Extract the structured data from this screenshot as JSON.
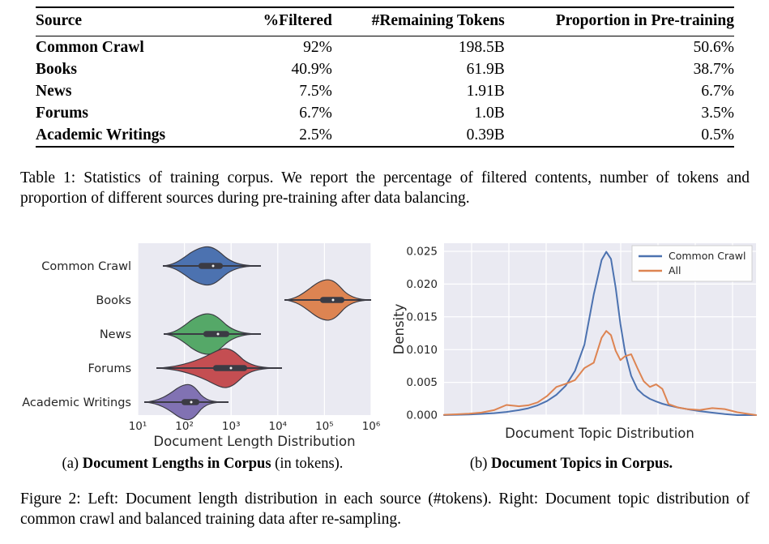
{
  "table": {
    "headers": [
      "Source",
      "%Filtered",
      "#Remaining Tokens",
      "Proportion in Pre-training"
    ],
    "rows": [
      {
        "source": "Common Crawl",
        "filtered": "92%",
        "tokens": "198.5B",
        "proportion": "50.6%"
      },
      {
        "source": "Books",
        "filtered": "40.9%",
        "tokens": "61.9B",
        "proportion": "38.7%"
      },
      {
        "source": "News",
        "filtered": "7.5%",
        "tokens": "1.91B",
        "proportion": "6.7%"
      },
      {
        "source": "Forums",
        "filtered": "6.7%",
        "tokens": "1.0B",
        "proportion": "3.5%"
      },
      {
        "source": "Academic Writings",
        "filtered": "2.5%",
        "tokens": "0.39B",
        "proportion": "0.5%"
      }
    ],
    "caption": "Table 1: Statistics of training corpus. We report the percentage of filtered contents, number of tokens and proportion of different sources during pre-training after data balancing."
  },
  "figure": {
    "caption": "Figure 2: Left: Document length distribution in each source (#tokens). Right: Document topic distribution of common crawl and balanced training data after re-sampling.",
    "subcaption_a_bold": "Document Lengths in Corpus",
    "subcaption_a_rest": " (in tokens).",
    "subcaption_a_prefix": "(a) ",
    "subcaption_b_bold": "Document Topics in Corpus.",
    "subcaption_b_prefix": "(b) "
  },
  "chart_data": [
    {
      "type": "violin",
      "panel": "a",
      "title": "Document Lengths in Corpus (in tokens)",
      "xlabel": "Document Length Distribution",
      "ylabel": "",
      "x_scale": "log10",
      "xlim": [
        1,
        6
      ],
      "xticks": [
        1,
        2,
        3,
        4,
        5,
        6
      ],
      "xticklabels": [
        "10¹",
        "10²",
        "10³",
        "10⁴",
        "10⁵",
        "10⁶"
      ],
      "grid": true,
      "categories": [
        "Common Crawl",
        "Books",
        "News",
        "Forums",
        "Academic Writings"
      ],
      "colors": [
        "#4C72B0",
        "#DD8452",
        "#55A868",
        "#C44E52",
        "#8172B3"
      ],
      "violins": [
        {
          "name": "Common Crawl",
          "color": "#4C72B0",
          "median": 2.78,
          "q1": 2.45,
          "q3": 3.02,
          "whisker_low": 1.72,
          "whisker_high": 3.52,
          "kde_center": 2.52,
          "kde_width": 0.52,
          "tail_low": 1.55,
          "tail_high": 3.95
        },
        {
          "name": "Books",
          "color": "#DD8452",
          "median": 5.18,
          "q1": 4.85,
          "q3": 5.4,
          "whisker_low": 4.02,
          "whisker_high": 5.92,
          "kde_center": 5.12,
          "kde_width": 0.5,
          "tail_low": 3.85,
          "tail_high": 6.0
        },
        {
          "name": "News",
          "color": "#55A868",
          "median": 2.85,
          "q1": 2.56,
          "q3": 3.02,
          "whisker_low": 1.75,
          "whisker_high": 3.5,
          "kde_center": 2.6,
          "kde_width": 0.52,
          "tail_low": 1.58,
          "tail_high": 3.9
        },
        {
          "name": "Forums",
          "color": "#C44E52",
          "median": 3.22,
          "q1": 2.82,
          "q3": 3.52,
          "whisker_low": 1.52,
          "whisker_high": 3.95,
          "kde_center": 3.02,
          "kde_width": 0.48,
          "tail_low": 1.4,
          "tail_high": 4.25
        },
        {
          "name": "Academic Writings",
          "color": "#8172B3",
          "median": 2.18,
          "q1": 2.0,
          "q3": 2.4,
          "whisker_low": 1.18,
          "whisker_high": 3.1,
          "kde_center": 2.1,
          "kde_width": 0.38,
          "tail_low": 1.05,
          "tail_high": 3.3
        }
      ]
    },
    {
      "type": "line",
      "panel": "b",
      "title": "Document Topics in Corpus",
      "xlabel": "Document Topic Distribution",
      "ylabel": "Density",
      "ylim": [
        0.0,
        0.0265
      ],
      "yticks": [
        0.0,
        0.005,
        0.01,
        0.015,
        0.02,
        0.025
      ],
      "yticklabels": [
        "0.000",
        "0.005",
        "0.010",
        "0.015",
        "0.020",
        "0.025"
      ],
      "xticklabels": [],
      "grid": true,
      "legend_position": "top-right",
      "legend": [
        "Common Crawl",
        "All"
      ],
      "colors": [
        "#4C72B0",
        "#DD8452"
      ],
      "x": [
        0.0,
        0.04,
        0.08,
        0.12,
        0.16,
        0.2,
        0.24,
        0.27,
        0.3,
        0.33,
        0.36,
        0.39,
        0.42,
        0.45,
        0.48,
        0.505,
        0.52,
        0.535,
        0.55,
        0.565,
        0.58,
        0.6,
        0.62,
        0.64,
        0.66,
        0.68,
        0.7,
        0.72,
        0.75,
        0.78,
        0.82,
        0.86,
        0.9,
        0.94,
        1.0
      ],
      "series": [
        {
          "name": "Common Crawl",
          "color": "#4C72B0",
          "values": [
            0.0,
            5e-05,
            0.0001,
            0.00018,
            0.0003,
            0.00048,
            0.00075,
            0.00105,
            0.0015,
            0.00215,
            0.0031,
            0.0045,
            0.0068,
            0.0108,
            0.0185,
            0.0238,
            0.0251,
            0.024,
            0.0195,
            0.014,
            0.0096,
            0.006,
            0.0043,
            0.0034,
            0.0028,
            0.0024,
            0.00205,
            0.0018,
            0.00148,
            0.00122,
            0.00092,
            0.00068,
            0.00045,
            0.00022,
            5e-05
          ]
        },
        {
          "name": "All",
          "color": "#DD8452",
          "values": [
            5e-05,
            0.00012,
            0.00022,
            0.00038,
            0.00075,
            0.00155,
            0.00135,
            0.0015,
            0.00195,
            0.0029,
            0.0043,
            0.0049,
            0.0056,
            0.0073,
            0.008,
            0.0118,
            0.01285,
            0.0122,
            0.0098,
            0.0084,
            0.009,
            0.0093,
            0.0072,
            0.0052,
            0.0043,
            0.0047,
            0.004,
            0.0023,
            0.0018,
            0.00155,
            0.0014,
            0.0017,
            0.00155,
            0.00095,
            0.0002
          ]
        }
      ]
    }
  ]
}
